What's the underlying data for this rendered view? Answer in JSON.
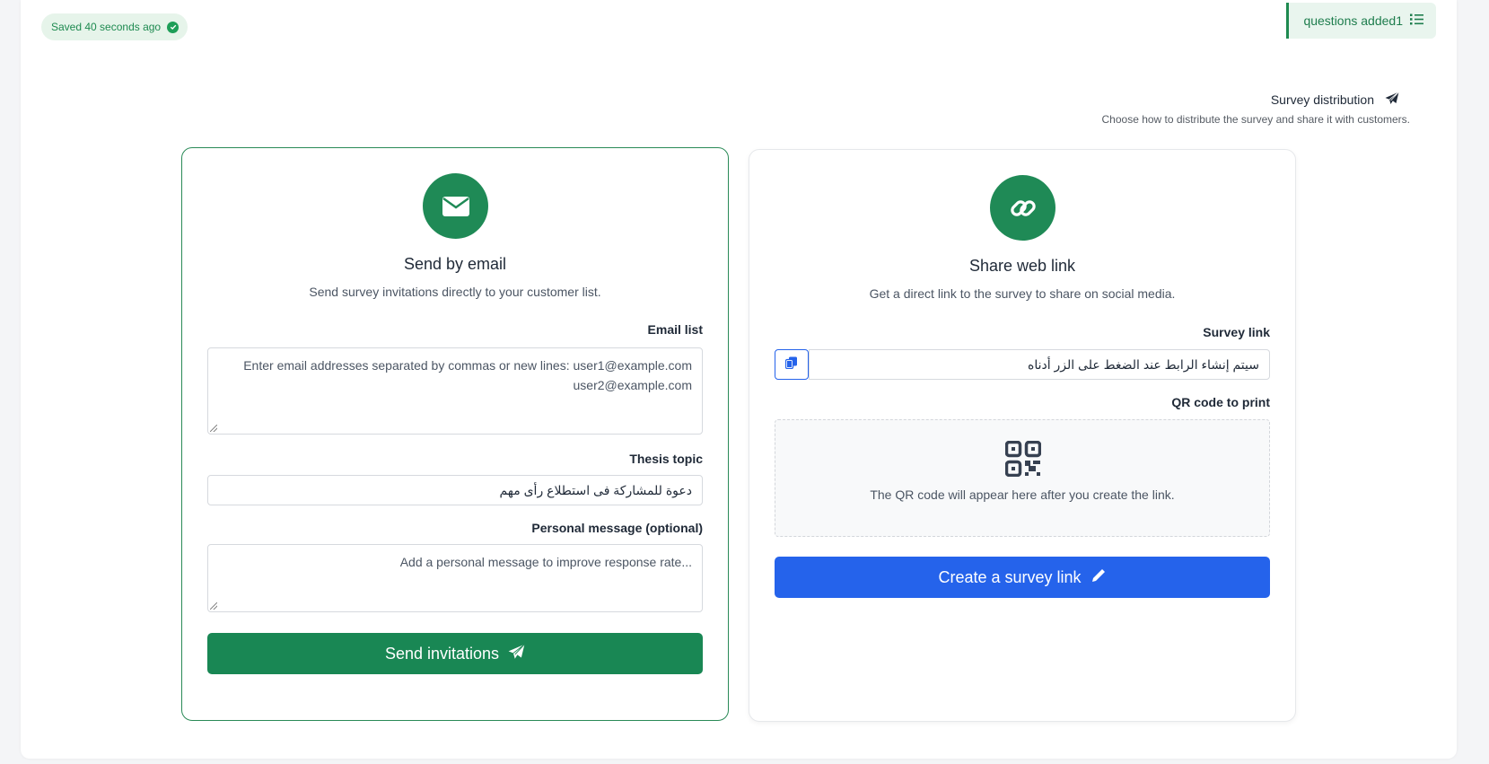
{
  "status": {
    "saved_text": "Saved 40 seconds ago",
    "questions_added": "questions added1"
  },
  "distribution": {
    "title": "Survey distribution",
    "subtitle": "Choose how to distribute the survey and share it with customers."
  },
  "email_card": {
    "title": "Send by email",
    "subtitle": "Send survey invitations directly to your customer list.",
    "email_list_label": "Email list",
    "email_list_placeholder_line1": "Enter email addresses separated by commas or new lines: user1@example.com",
    "email_list_placeholder_line2": "user2@example.com",
    "topic_label": "Thesis topic",
    "topic_value": "دعوة للمشاركة فى استطلاع رأى مهم",
    "message_label": "Personal message (optional)",
    "message_placeholder": "Add a personal message to improve response rate...",
    "send_button": "Send invitations"
  },
  "link_card": {
    "title": "Share web link",
    "subtitle": "Get a direct link to the survey to share on social media.",
    "link_label": "Survey link",
    "link_value": "سيتم إنشاء الرابط عند الضغط على الزر أدناه",
    "qr_label": "QR code to print",
    "qr_text": "The QR code will appear here after you create the link.",
    "create_button": "Create a survey link"
  },
  "colors": {
    "primary_green": "#198754",
    "primary_blue": "#2563eb",
    "badge_green_bg": "#e6f4ea"
  }
}
